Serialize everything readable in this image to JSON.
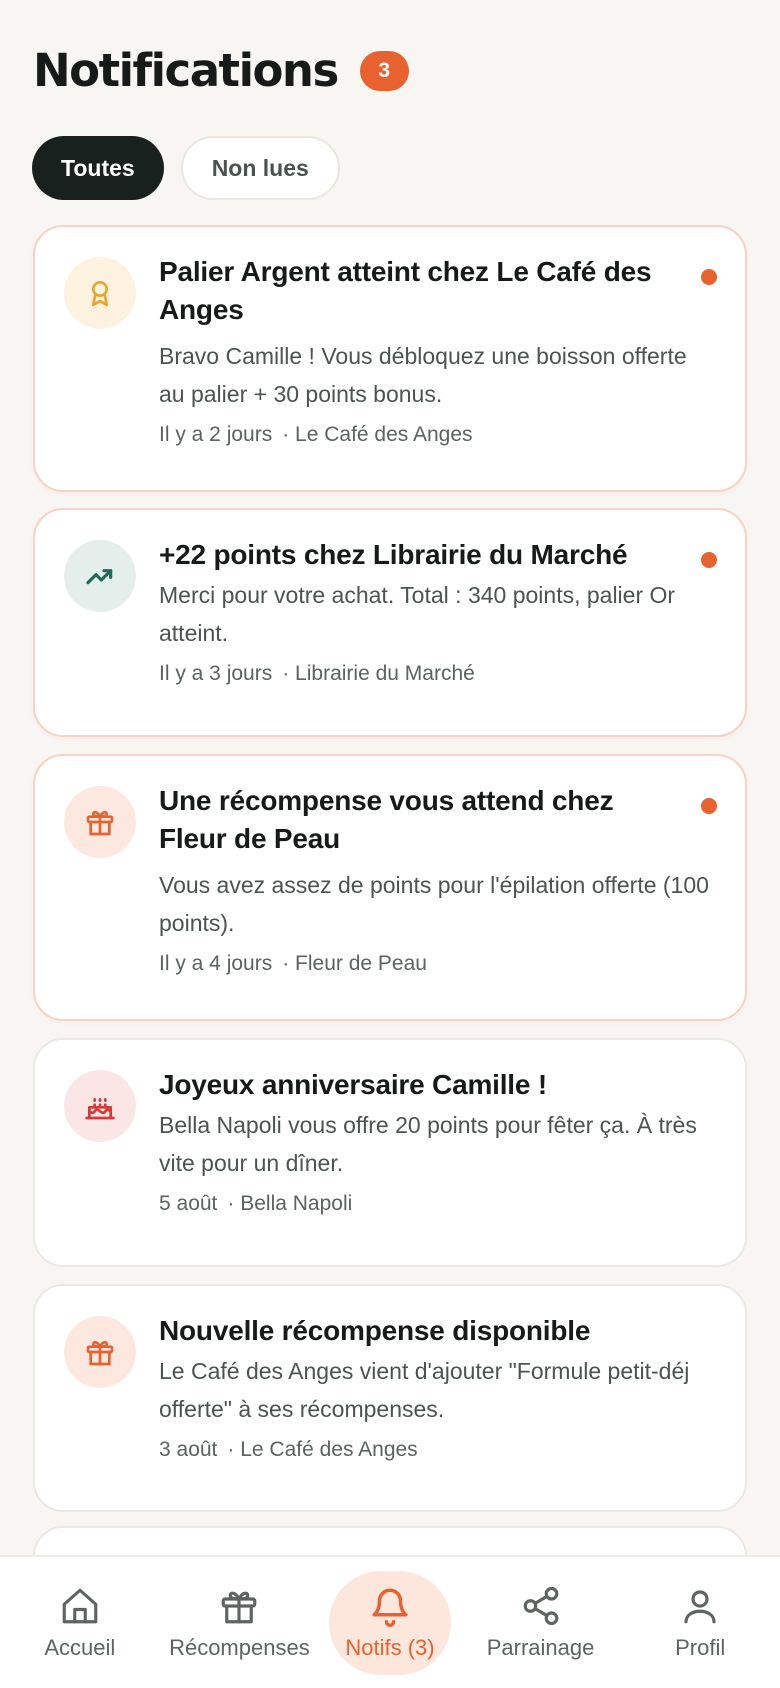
{
  "header": {
    "title": "Notifications",
    "unread_count": "3"
  },
  "filters": {
    "all": "Toutes",
    "unread": "Non lues"
  },
  "notifications": [
    {
      "icon": "award-icon",
      "title": "Palier Argent atteint chez Le Café des Anges",
      "body": "Bravo Camille ! Vous débloquez une boisson offerte au palier + 30 points bonus.",
      "time": "Il y a 2 jours",
      "merchant": "· Le Café des Anges",
      "unread": true
    },
    {
      "icon": "trending-up-icon",
      "title": "+22 points chez Librairie du Marché",
      "body": "Merci pour votre achat. Total : 340 points, palier Or atteint.",
      "time": "Il y a 3 jours",
      "merchant": "· Librairie du Marché",
      "unread": true
    },
    {
      "icon": "gift-icon",
      "title": "Une récompense vous attend chez Fleur de Peau",
      "body": "Vous avez assez de points pour l'épilation offerte (100 points).",
      "time": "Il y a 4 jours",
      "merchant": "· Fleur de Peau",
      "unread": true
    },
    {
      "icon": "cake-icon",
      "title": "Joyeux anniversaire Camille !",
      "body": "Bella Napoli vous offre 20 points pour fêter ça. À très vite pour un dîner.",
      "time": "5 août",
      "merchant": "· Bella Napoli",
      "unread": false
    },
    {
      "icon": "gift-icon",
      "title": "Nouvelle récompense disponible",
      "body": "Le Café des Anges vient d'ajouter \"Formule petit-déj offerte\" à ses récompenses.",
      "time": "3 août",
      "merchant": "· Le Café des Anges",
      "unread": false
    }
  ],
  "nav": {
    "home": "Accueil",
    "rewards": "Récompenses",
    "notifs": "Notifs (3)",
    "referral": "Parrainage",
    "profile": "Profil"
  },
  "colors": {
    "accent": "#e8622f",
    "dark": "#18211e",
    "background": "#f8f6f3"
  }
}
